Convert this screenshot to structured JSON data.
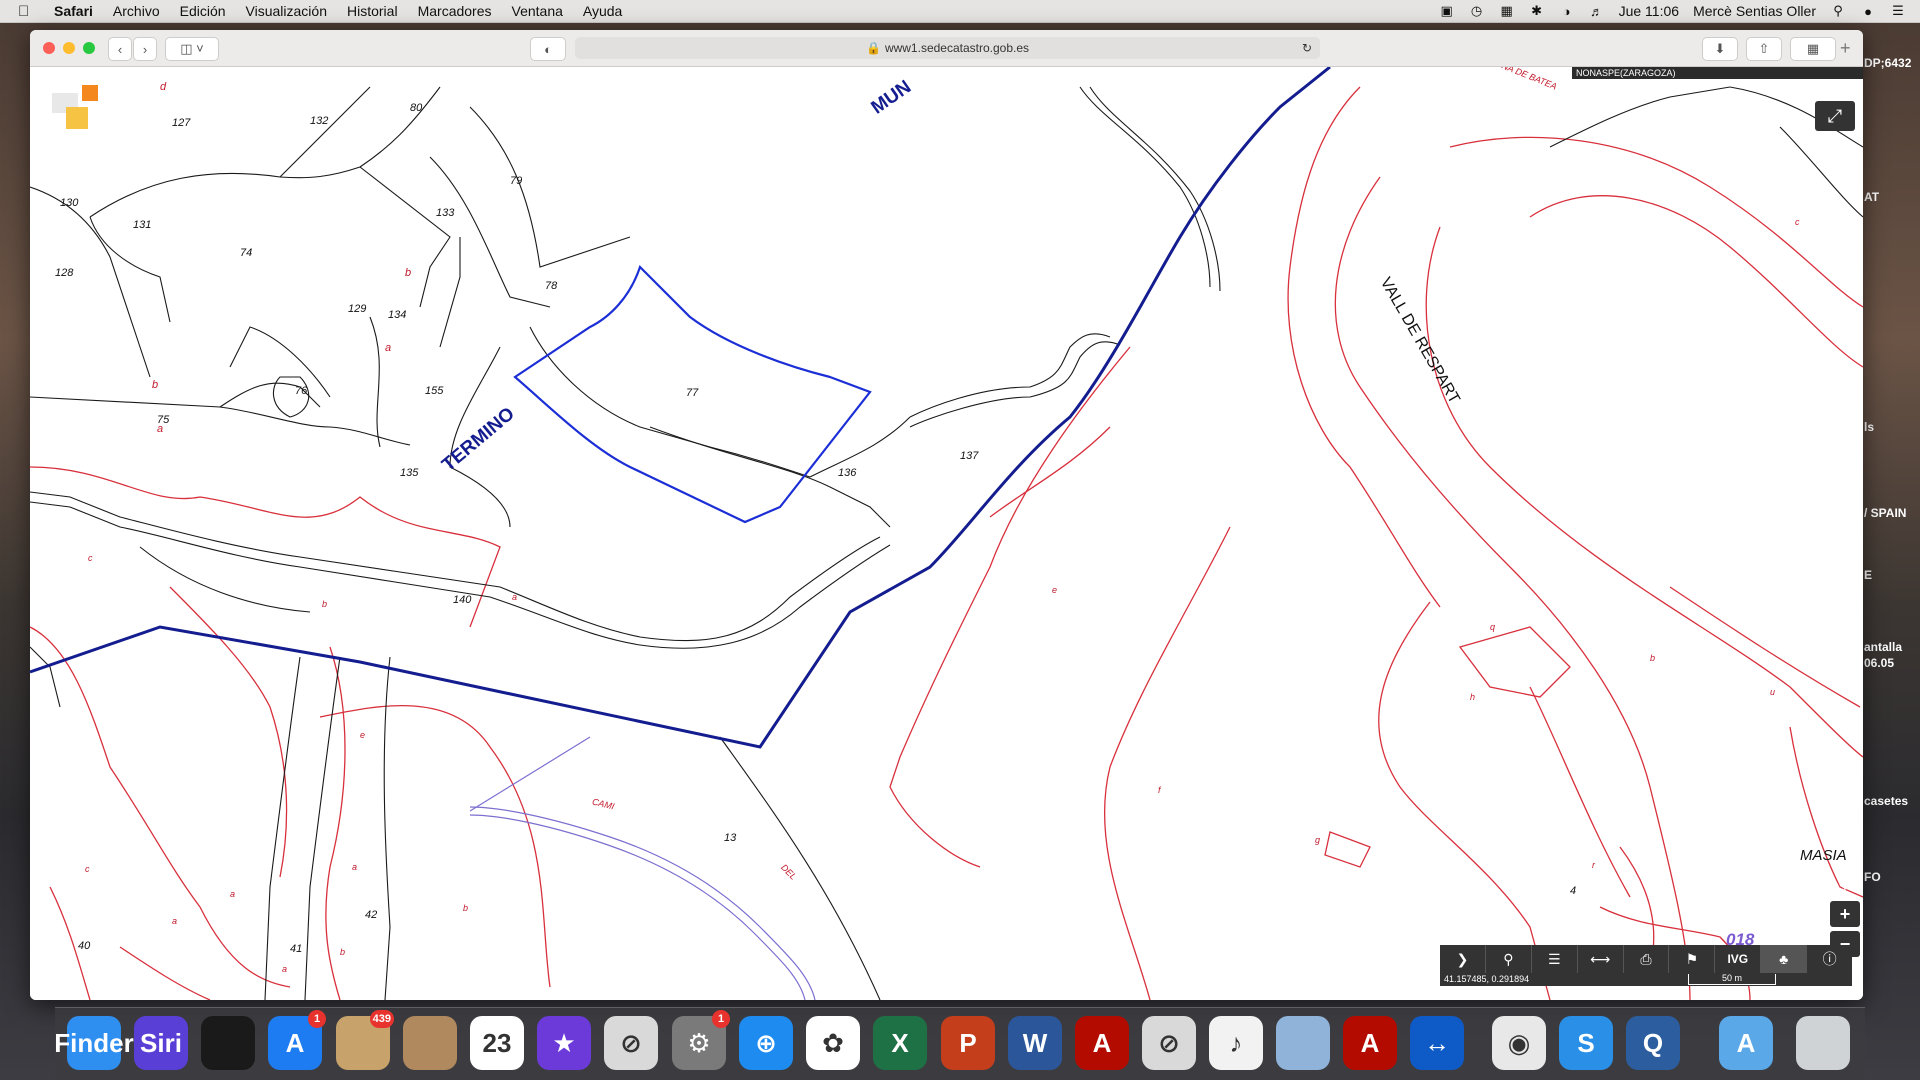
{
  "menubar": {
    "app_name": "Safari",
    "items": [
      "Archivo",
      "Edición",
      "Visualización",
      "Historial",
      "Marcadores",
      "Ventana",
      "Ayuda"
    ],
    "clock": "Jue 11:06",
    "user": "Mercè Sentias Oller"
  },
  "browser": {
    "url": "www1.sedecatastro.gob.es"
  },
  "map": {
    "municipality": "NONASPE(ZARAGOZA)",
    "big_labels": [
      "MUN",
      "TERMINO",
      "VALL DE RESPART"
    ],
    "parcels_black": [
      "d",
      "132",
      "80",
      "127",
      "79",
      "133",
      "130",
      "131",
      "74",
      "128",
      "b",
      "78",
      "129",
      "134",
      "77",
      "a",
      "76",
      "155",
      "b",
      "75",
      "a",
      "136",
      "137",
      "135"
    ],
    "parcels_red": [
      "c",
      "b",
      "140",
      "a",
      "e",
      "q",
      "b",
      "u",
      "c",
      "h",
      "e",
      "CAMI",
      "13",
      "DEL",
      "f",
      "g",
      "a",
      "c",
      "a",
      "b",
      "42",
      "a",
      "40",
      "41",
      "b",
      "a",
      "r",
      "4",
      "NA DE BATEA"
    ],
    "sheet_code": "018",
    "masia_label": "MASIA",
    "coords": "41.157485, 0.291894",
    "scale": "50 m"
  },
  "map_toolbar": [
    "next",
    "search",
    "layers",
    "measure",
    "print",
    "streetview",
    "IVG",
    "overlay",
    "info"
  ],
  "desktop_right_labels": [
    "DP;6432",
    "AT",
    "ls",
    "/ SPAIN",
    "E",
    "antalla",
    "06.05",
    "casetes",
    "FO"
  ],
  "dock": [
    {
      "name": "finder",
      "label": "Finder",
      "color": "#2f8ff0"
    },
    {
      "name": "siri",
      "label": "Siri",
      "color": "#5a3fd6"
    },
    {
      "name": "photo-booth",
      "label": "",
      "color": "#1a1a1a"
    },
    {
      "name": "app-store",
      "label": "A",
      "color": "#1e7cf2",
      "badge": "1"
    },
    {
      "name": "mail-stamp",
      "label": "",
      "color": "#c8a26b",
      "badge": "439"
    },
    {
      "name": "contacts",
      "label": "",
      "color": "#b0895e"
    },
    {
      "name": "calendar",
      "label": "23",
      "color": "#ffffff"
    },
    {
      "name": "imovie",
      "label": "★",
      "color": "#6b3ad8"
    },
    {
      "name": "disabled-app-1",
      "label": "⊘",
      "color": "#d9d9d9"
    },
    {
      "name": "system-preferences",
      "label": "⚙",
      "color": "#7a7a7a",
      "badge": "1"
    },
    {
      "name": "safari",
      "label": "⊕",
      "color": "#1d8bf0"
    },
    {
      "name": "photos",
      "label": "✿",
      "color": "#ffffff"
    },
    {
      "name": "excel",
      "label": "X",
      "color": "#1e7145"
    },
    {
      "name": "powerpoint",
      "label": "P",
      "color": "#c43e1c"
    },
    {
      "name": "word",
      "label": "W",
      "color": "#2b579a"
    },
    {
      "name": "acrobat",
      "label": "A",
      "color": "#b30b00"
    },
    {
      "name": "disabled-app-2",
      "label": "⊘",
      "color": "#d9d9d9"
    },
    {
      "name": "itunes",
      "label": "♪",
      "color": "#f2f2f2"
    },
    {
      "name": "preview",
      "label": "",
      "color": "#8fb3d9"
    },
    {
      "name": "acrobat-2",
      "label": "A",
      "color": "#b30b00"
    },
    {
      "name": "teamviewer",
      "label": "↔",
      "color": "#0e5ac7"
    },
    {
      "name": "chrome",
      "label": "◉",
      "color": "#e8e8e8"
    },
    {
      "name": "skype",
      "label": "S",
      "color": "#2a8fe6"
    },
    {
      "name": "quicktime",
      "label": "Q",
      "color": "#2c5e9f"
    },
    {
      "name": "applications-folder",
      "label": "A",
      "color": "#5aa8e8"
    },
    {
      "name": "trash",
      "label": "",
      "color": "#cfd3d6"
    }
  ]
}
